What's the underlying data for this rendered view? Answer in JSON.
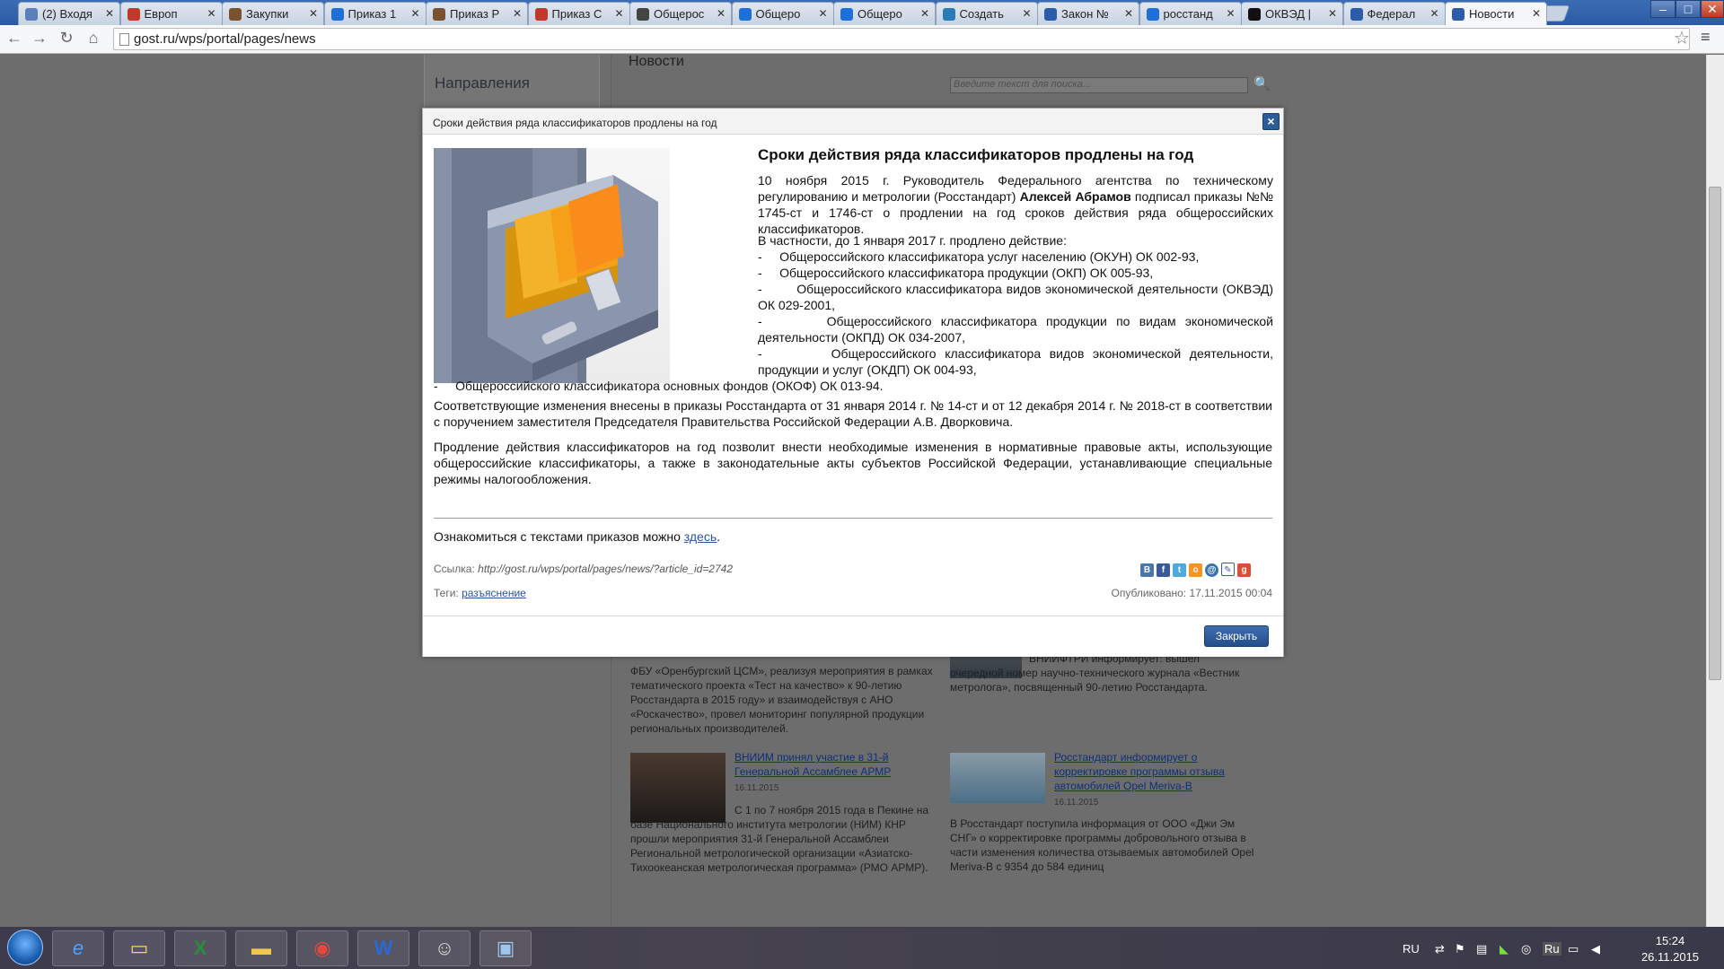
{
  "browser": {
    "tabs": [
      {
        "label": "(2) Входя",
        "color": "#5b7fb8"
      },
      {
        "label": "Европ",
        "color": "#c0392b"
      },
      {
        "label": "Закупки",
        "color": "#7a5230"
      },
      {
        "label": "Приказ 1",
        "color": "#1e6fd9"
      },
      {
        "label": "Приказ Р",
        "color": "#7a5230"
      },
      {
        "label": "Приказ С",
        "color": "#c0392b"
      },
      {
        "label": "Общерос",
        "color": "#444444"
      },
      {
        "label": "Общеро",
        "color": "#1e6fd9"
      },
      {
        "label": "Общеро",
        "color": "#1e6fd9"
      },
      {
        "label": "Создать",
        "color": "#2a7ab8"
      },
      {
        "label": "Закон №",
        "color": "#2a5caa"
      },
      {
        "label": "росстанд",
        "color": "#1e6fd9"
      },
      {
        "label": "ОКВЭД |",
        "color": "#111111"
      },
      {
        "label": "Федерал",
        "color": "#2a5caa"
      },
      {
        "label": "Новости",
        "color": "#2a5caa"
      }
    ],
    "url": "gost.ru/wps/portal/pages/news"
  },
  "page": {
    "sidebar_heading": "Направления",
    "news_heading": "Новости",
    "search_placeholder": "Введите текст для поиска..."
  },
  "background_news": [
    {
      "text": "ФБУ «Оренбургский ЦСМ», реализуя мероприятия в рамках тематического проекта «Тест на качество» к 90-летию Росстандарта в 2015 году» и взаимодействуя с АНО «Роскачество», провел мониторинг популярной продукции региональных производителей."
    },
    {
      "text": "ВНИИФТРИ информирует: вышел очередной номер научно-технического журнала «Вестник метролога», посвященный 90-летию Росстандарта."
    },
    {
      "title": "ВНИИМ принял участие в 31-й Генеральной Ассамблее АРМР",
      "date": "16.11.2015",
      "text": "С 1 по 7 ноября 2015 года в Пекине на базе Национального института метрологии (НИМ) КНР прошли мероприятия 31-й Генеральной Ассамблеи Региональной метрологической организации «Азиатско-Тихоокеанская метрологическая программа» (РМО АРМР)."
    },
    {
      "title": "Росстандарт информирует о корректировке программы отзыва автомобилей Opel Meriva-B",
      "date": "16.11.2015",
      "text": "В Росстандарт поступила информация от ООО «Джи Эм СНГ» о корректировке программы добровольного отзыва в части изменения количества отзываемых автомобилей Opel Meriva-B с 9354 до 584 единиц"
    }
  ],
  "modal": {
    "header": "Сроки действия ряда классификаторов продлены на год",
    "title": "Сроки действия ряда классификаторов продлены на год",
    "intro_before": "10 ноября 2015 г. Руководитель Федерального агентства по техническому регулированию и метрологии (Росстандарт) ",
    "intro_bold": "Алексей Абрамов",
    "intro_after": " подписал приказы №№ 1745-ст и 1746-ст о продлении на год сроков действия ряда общероссийских классификаторов.",
    "list_intro": "В частности, до 1 января 2017 г. продлено действие:",
    "list": [
      "Общероссийского классификатора услуг населению (ОКУН) ОК 002-93,",
      "Общероссийского классификатора продукции (ОКП) ОК 005-93,",
      "Общероссийского классификатора видов экономической деятельности (ОКВЭД) ОК 029-2001,",
      "Общероссийского классификатора продукции по видам экономической деятельности (ОКПД) ОК 034-2007,",
      "Общероссийского классификатора видов экономической деятельности, продукции и услуг (ОКДП) ОК 004-93,",
      "Общероссийского классификатора основных фондов (ОКОФ) ОК 013-94."
    ],
    "para2": "Соответствующие изменения внесены в приказы Росстандарта от 31 января 2014 г. № 14-ст и от 12 декабря 2014 г. № 2018-ст в соответствии с поручением заместителя Председателя Правительства Российской Федерации А.В. Дворковича.",
    "para3": "Продление действия классификаторов на год позволит внести необходимые изменения в нормативные правовые акты, использующие общероссийские классификаторы, а также в законодательные акты субъектов Российской Федерации, устанавливающие специальные режимы налогообложения.",
    "read_text": "Ознакомиться с текстами приказов можно ",
    "read_link": "здесь",
    "ref_label": "Ссылка: ",
    "ref_url": "http://gost.ru/wps/portal/pages/news/?article_id=2742",
    "tags_label": "Теги: ",
    "tag": "разъяснение",
    "published": "Опубликовано: 17.11.2015 00:04",
    "close_button": "Закрыть"
  },
  "taskbar": {
    "lang": "RU",
    "lang2": "Ru",
    "time": "15:24",
    "date": "26.11.2015"
  }
}
